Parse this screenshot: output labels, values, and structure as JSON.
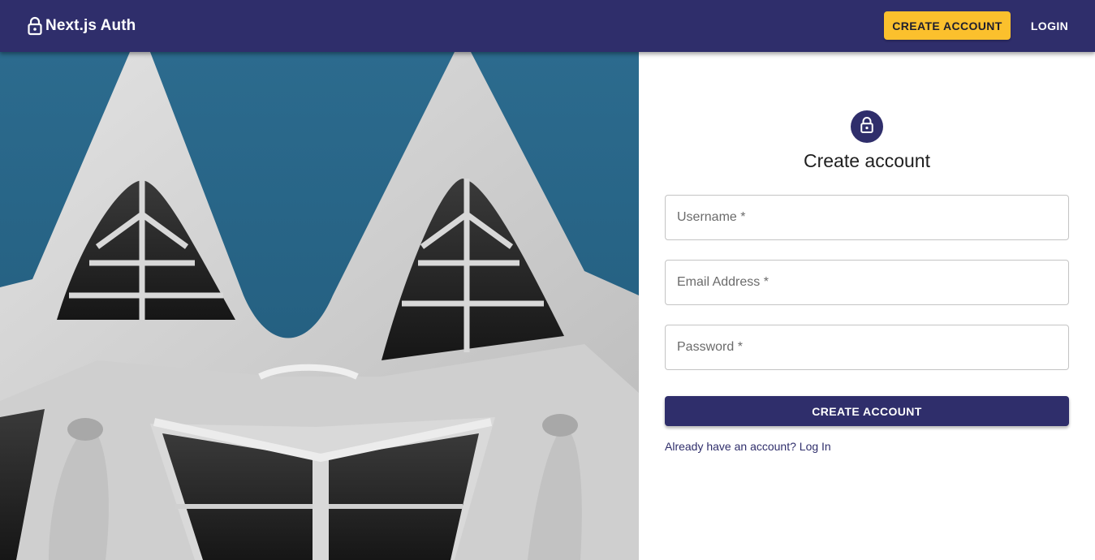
{
  "app": {
    "brand": "Next.js Auth",
    "icon": "lock-icon"
  },
  "header": {
    "create_account_label": "CREATE ACCOUNT",
    "login_label": "LOGIN"
  },
  "hero": {
    "image": "architecture-photo"
  },
  "form": {
    "title": "Create account",
    "icon": "lock-icon",
    "username_placeholder": "Username *",
    "email_placeholder": "Email Address *",
    "password_placeholder": "Password *",
    "submit_label": "CREATE ACCOUNT",
    "login_link": "Already have an account? Log In"
  },
  "colors": {
    "primary": "#2f2e6b",
    "accent": "#fbc02d",
    "sky": "#2b6a8c"
  }
}
